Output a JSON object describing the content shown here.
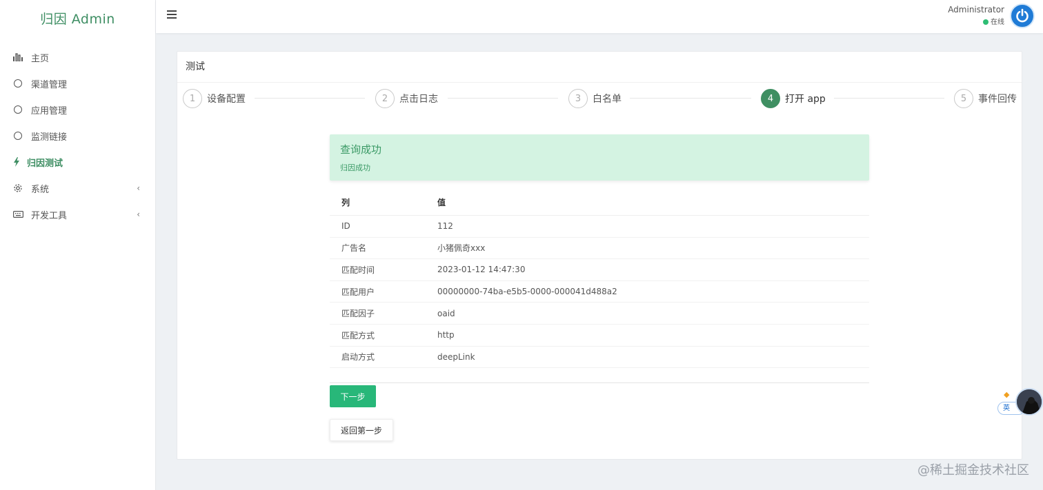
{
  "brand": "归因 Admin",
  "sidebar": {
    "items": [
      {
        "label": "主页",
        "icon": "bar-chart-icon"
      },
      {
        "label": "渠道管理",
        "icon": "circle-icon"
      },
      {
        "label": "应用管理",
        "icon": "circle-icon"
      },
      {
        "label": "监测链接",
        "icon": "circle-icon"
      },
      {
        "label": "归因测试",
        "icon": "bolt-icon",
        "active": true
      },
      {
        "label": "系统",
        "icon": "gear-icon",
        "caret": "‹"
      },
      {
        "label": "开发工具",
        "icon": "keyboard-icon",
        "caret": "‹"
      }
    ]
  },
  "header": {
    "user_name": "Administrator",
    "status": "在线"
  },
  "card": {
    "title": "测试"
  },
  "steps": [
    {
      "num": "1",
      "label": "设备配置"
    },
    {
      "num": "2",
      "label": "点击日志"
    },
    {
      "num": "3",
      "label": "白名单"
    },
    {
      "num": "4",
      "label": "打开 app",
      "active": true
    },
    {
      "num": "5",
      "label": "事件回传"
    }
  ],
  "alert": {
    "title": "查询成功",
    "desc": "归因成功"
  },
  "table": {
    "headers": [
      "列",
      "值"
    ],
    "rows": [
      [
        "ID",
        "112"
      ],
      [
        "广告名",
        "小猪佩奇xxx"
      ],
      [
        "匹配时间",
        "2023-01-12 14:47:30"
      ],
      [
        "匹配用户",
        "00000000-74ba-e5b5-0000-000041d488a2"
      ],
      [
        "匹配因子",
        "oaid"
      ],
      [
        "匹配方式",
        "http"
      ],
      [
        "启动方式",
        "deepLink"
      ]
    ]
  },
  "buttons": {
    "next": "下一步",
    "back": "返回第一步"
  },
  "widget": {
    "badge": "英"
  },
  "watermark": "@稀土掘金技术社区",
  "colors": {
    "primary": "#3e8e63",
    "success_bg": "#d4f3e2",
    "button_green": "#28b779",
    "avatar_blue": "#1f7bd6"
  }
}
